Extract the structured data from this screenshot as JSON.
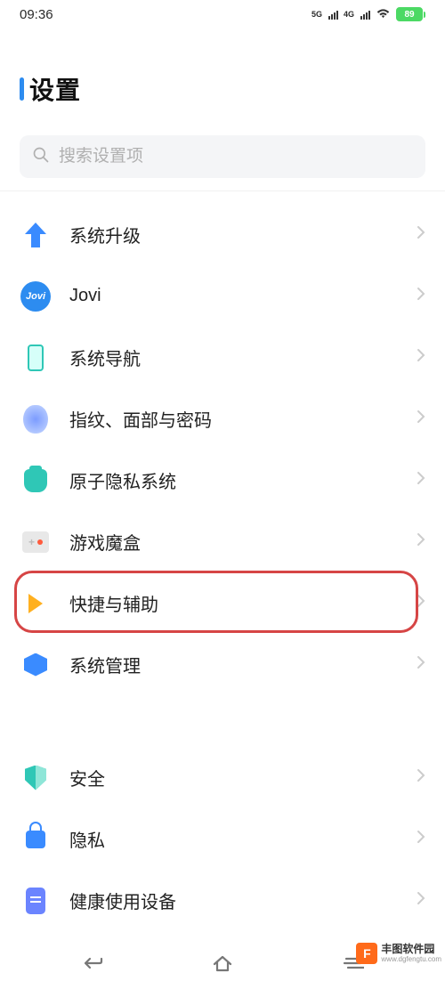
{
  "status": {
    "time": "09:36",
    "net1": "5G",
    "net2": "4G",
    "battery": "89"
  },
  "title": "设置",
  "search": {
    "placeholder": "搜索设置项"
  },
  "group1": [
    {
      "key": "system-upgrade",
      "label": "系统升级",
      "icon": "arrow-up-icon"
    },
    {
      "key": "jovi",
      "label": "Jovi",
      "icon": "jovi-icon"
    },
    {
      "key": "system-nav",
      "label": "系统导航",
      "icon": "phone-icon"
    },
    {
      "key": "fingerprint",
      "label": "指纹、面部与密码",
      "icon": "fingerprint-icon"
    },
    {
      "key": "atom-privacy",
      "label": "原子隐私系统",
      "icon": "atom-icon"
    },
    {
      "key": "game-box",
      "label": "游戏魔盒",
      "icon": "gamepad-icon"
    },
    {
      "key": "shortcuts",
      "label": "快捷与辅助",
      "icon": "fast-arrow-icon",
      "highlight": true
    },
    {
      "key": "system-mgmt",
      "label": "系统管理",
      "icon": "hexagon-icon"
    }
  ],
  "group2": [
    {
      "key": "security",
      "label": "安全",
      "icon": "shield-icon"
    },
    {
      "key": "privacy",
      "label": "隐私",
      "icon": "lock-icon"
    },
    {
      "key": "digital-health",
      "label": "健康使用设备",
      "icon": "health-icon"
    }
  ],
  "watermark": {
    "badge": "F",
    "main": "丰图软件园",
    "sub": "www.dgfengtu.com"
  }
}
